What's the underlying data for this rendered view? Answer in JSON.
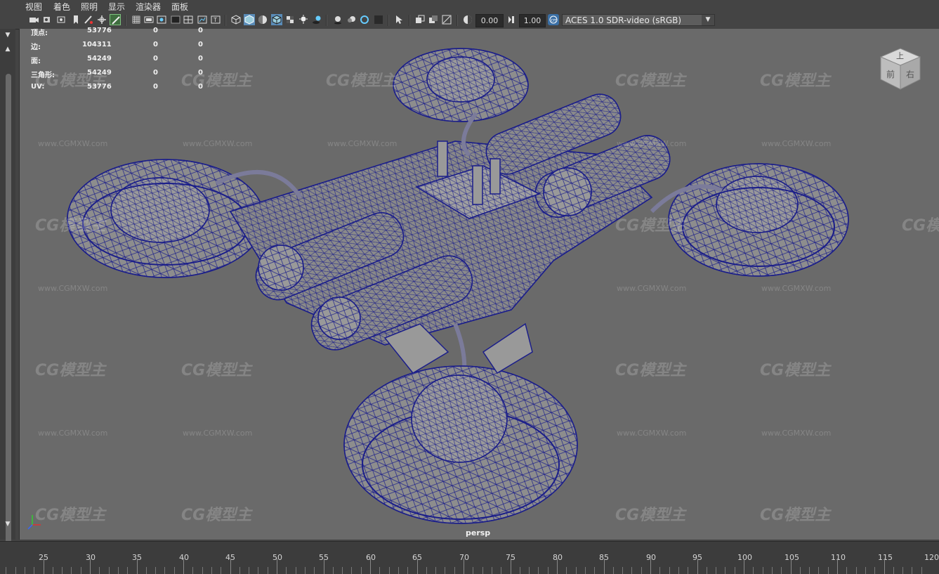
{
  "menu": [
    "视图",
    "着色",
    "照明",
    "显示",
    "渲染器",
    "面板"
  ],
  "toolbar": {
    "exposure_value": "0.00",
    "gamma_value": "1.00",
    "color_space": "ACES 1.0 SDR-video (sRGB)"
  },
  "hud": {
    "rows": [
      {
        "label": "顶点:",
        "value": "53776",
        "c2": "0",
        "c3": "0"
      },
      {
        "label": "边:",
        "value": "104311",
        "c2": "0",
        "c3": "0"
      },
      {
        "label": "面:",
        "value": "54249",
        "c2": "0",
        "c3": "0"
      },
      {
        "label": "三角形:",
        "value": "54249",
        "c2": "0",
        "c3": "0"
      },
      {
        "label": "UV:",
        "value": "53776",
        "c2": "0",
        "c3": "0"
      }
    ]
  },
  "viewcube": {
    "top": "上",
    "front": "前",
    "right": "右"
  },
  "camera_label": "persp",
  "watermark": {
    "logo": "CG模型主",
    "url": "www.CGMXW.com"
  },
  "timeline": {
    "ticks": [
      "25",
      "30",
      "35",
      "40",
      "45",
      "50",
      "55",
      "60",
      "65",
      "70",
      "75",
      "80",
      "85",
      "90",
      "95",
      "100",
      "105",
      "110",
      "115",
      "120"
    ]
  },
  "colors": {
    "wireframe": "#1b1e8a",
    "viewport_bg": "#6a6a6a",
    "ui_bg": "#444444"
  }
}
